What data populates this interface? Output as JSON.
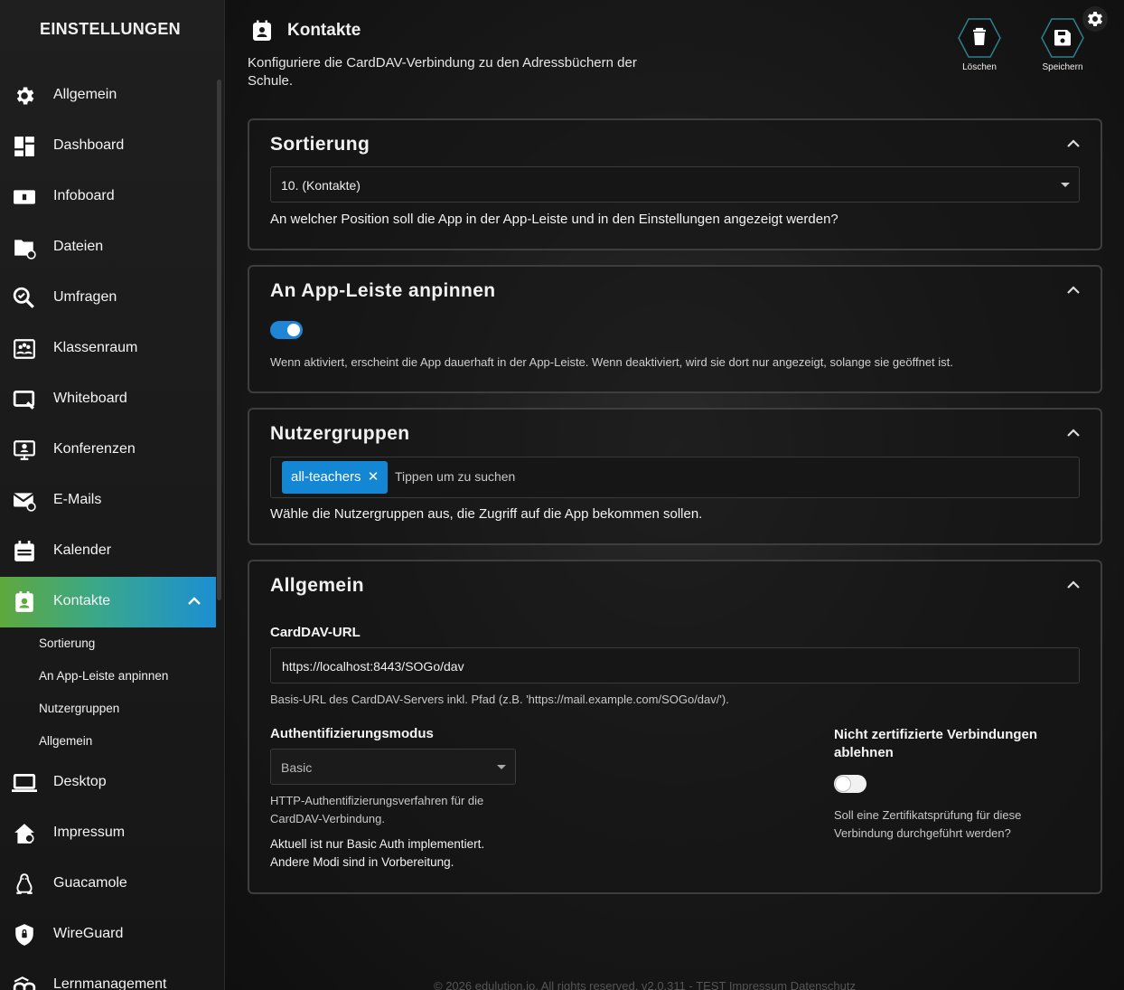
{
  "sidebar": {
    "title": "EINSTELLUNGEN",
    "items": [
      {
        "label": "Allgemein",
        "icon": "gear-icon"
      },
      {
        "label": "Dashboard",
        "icon": "dashboard-icon"
      },
      {
        "label": "Infoboard",
        "icon": "infoboard-icon"
      },
      {
        "label": "Dateien",
        "icon": "folder-icon"
      },
      {
        "label": "Umfragen",
        "icon": "survey-icon"
      },
      {
        "label": "Klassenraum",
        "icon": "classroom-icon"
      },
      {
        "label": "Whiteboard",
        "icon": "whiteboard-icon"
      },
      {
        "label": "Konferenzen",
        "icon": "conference-icon"
      },
      {
        "label": "E-Mails",
        "icon": "mail-icon"
      },
      {
        "label": "Kalender",
        "icon": "calendar-icon"
      },
      {
        "label": "Kontakte",
        "icon": "contacts-icon"
      },
      {
        "label": "Desktop",
        "icon": "desktop-icon"
      },
      {
        "label": "Impressum",
        "icon": "home-icon"
      },
      {
        "label": "Guacamole",
        "icon": "linux-icon"
      },
      {
        "label": "WireGuard",
        "icon": "shield-icon"
      },
      {
        "label": "Lernmanagement",
        "icon": "moodle-icon"
      }
    ],
    "sub_items": [
      "Sortierung",
      "An App-Leiste anpinnen",
      "Nutzergruppen",
      "Allgemein"
    ]
  },
  "header": {
    "title": "Kontakte",
    "description": "Konfiguriere die CardDAV-Verbindung zu den Adressbüchern der Schule.",
    "delete_label": "Löschen",
    "save_label": "Speichern"
  },
  "sorting": {
    "title": "Sortierung",
    "selected": "10. (Kontakte)",
    "help": "An welcher Position soll die App in der App-Leiste und in den Einstellungen angezeigt werden?"
  },
  "pin": {
    "title": "An App-Leiste anpinnen",
    "enabled": true,
    "help": "Wenn aktiviert, erscheint die App dauerhaft in der App-Leiste. Wenn deaktiviert, wird sie dort nur angezeigt, solange sie geöffnet ist."
  },
  "groups": {
    "title": "Nutzergruppen",
    "tags": [
      "all-teachers"
    ],
    "placeholder": "Tippen um zu suchen",
    "help": "Wähle die Nutzergruppen aus, die Zugriff auf die App bekommen sollen."
  },
  "general": {
    "title": "Allgemein",
    "carddav_label": "CardDAV-URL",
    "carddav_value": "https://localhost:8443/SOGo/dav",
    "carddav_help": "Basis-URL des CardDAV-Servers inkl. Pfad (z.B. 'https://mail.example.com/SOGo/dav/').",
    "auth_label": "Authentifizierungsmodus",
    "auth_selected": "Basic",
    "auth_help": "HTTP-Authentifizierungsverfahren für die CardDAV-Verbindung.",
    "auth_note": "Aktuell ist nur Basic Auth implementiert. Andere Modi sind in Vorbereitung.",
    "reject_label": "Nicht zertifizierte Verbindungen ablehnen",
    "reject_enabled": false,
    "reject_help": "Soll eine Zertifikatsprüfung für diese Verbindung durchgeführt werden?"
  },
  "footer": {
    "text": "© 2026 edulution.io. All rights reserved. v2.0.311  -  TEST  Impressum  Datenschutz"
  },
  "colors": {
    "accent_blue": "#1386d4",
    "accent_green": "#5fa83c"
  }
}
